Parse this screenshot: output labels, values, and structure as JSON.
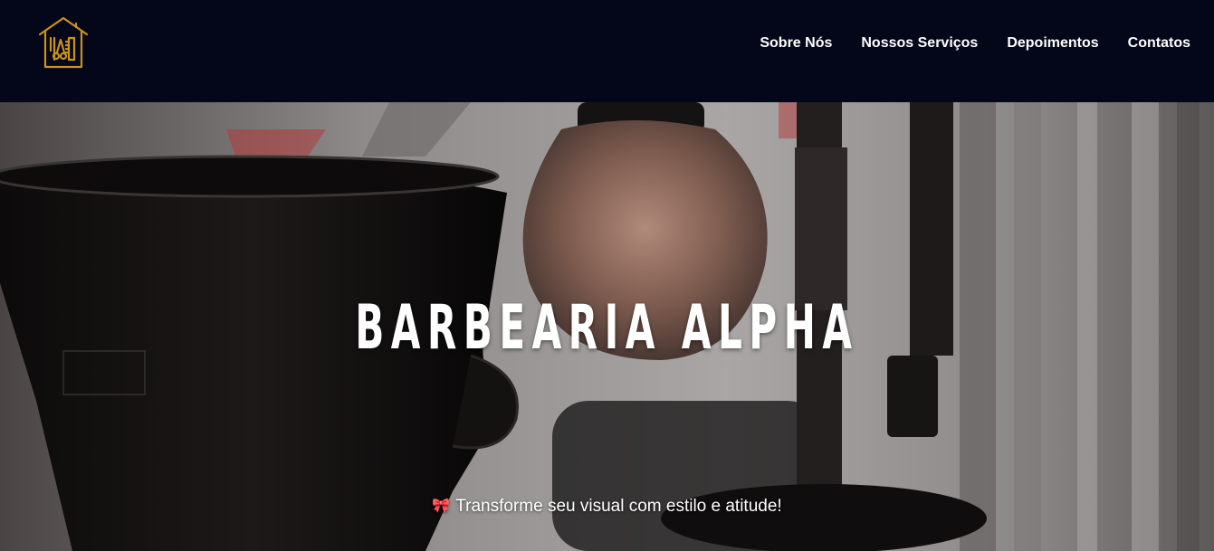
{
  "brand": {
    "logo_icon": "barbershop-house-icon",
    "accent_color": "#c9921f"
  },
  "nav": {
    "items": [
      {
        "label": "Sobre Nós"
      },
      {
        "label": "Nossos Serviços"
      },
      {
        "label": "Depoimentos"
      },
      {
        "label": "Contatos"
      }
    ]
  },
  "hero": {
    "title": "BARBEARIA ALPHA",
    "tagline_icon": "ribbon-icon",
    "tagline": "Transforme seu visual com estilo e atitude!"
  },
  "colors": {
    "header_bg": "#04061a",
    "text": "#ffffff"
  }
}
